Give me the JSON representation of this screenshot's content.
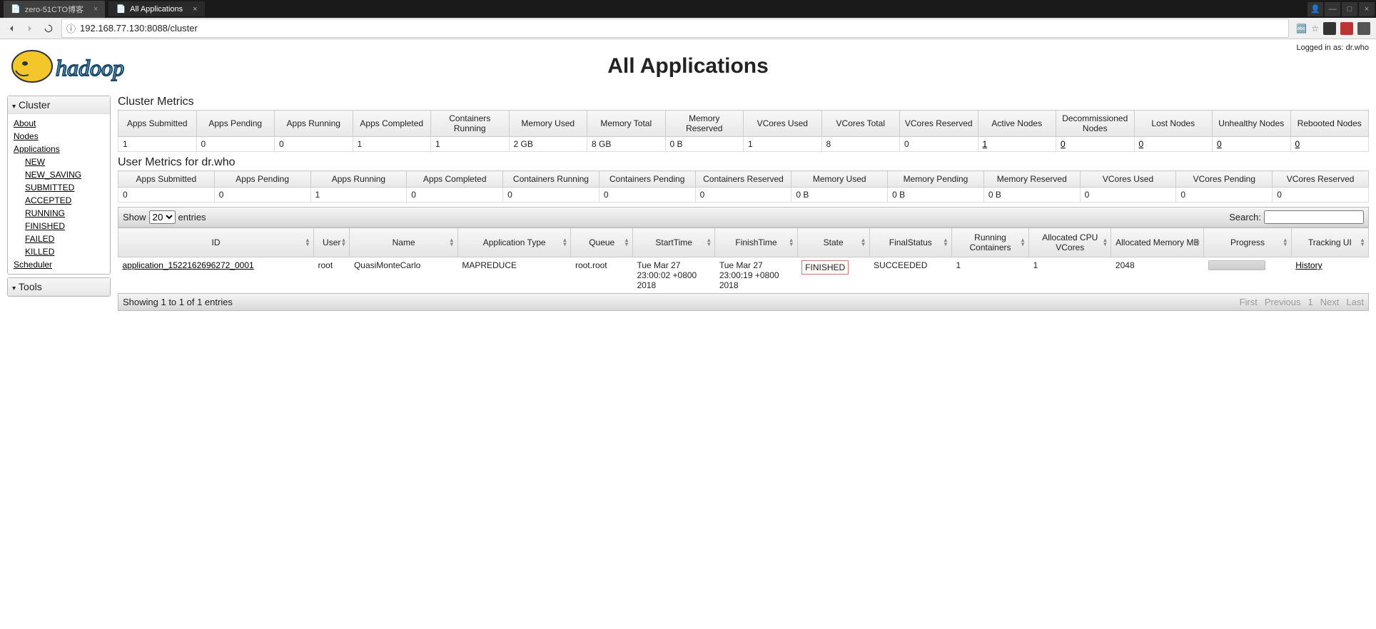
{
  "browser": {
    "tab1": "zero-51CTO博客",
    "tab2": "All Applications",
    "url": "192.168.77.130:8088/cluster"
  },
  "header": {
    "logged_in_prefix": "Logged in as: ",
    "logged_in_user": "dr.who",
    "page_title": "All Applications"
  },
  "sidebar": {
    "cluster_label": "Cluster",
    "about": "About",
    "nodes": "Nodes",
    "applications": "Applications",
    "app_states": [
      "NEW",
      "NEW_SAVING",
      "SUBMITTED",
      "ACCEPTED",
      "RUNNING",
      "FINISHED",
      "FAILED",
      "KILLED"
    ],
    "scheduler": "Scheduler",
    "tools_label": "Tools"
  },
  "cluster_metrics": {
    "title": "Cluster Metrics",
    "headers": [
      "Apps Submitted",
      "Apps Pending",
      "Apps Running",
      "Apps Completed",
      "Containers Running",
      "Memory Used",
      "Memory Total",
      "Memory Reserved",
      "VCores Used",
      "VCores Total",
      "VCores Reserved",
      "Active Nodes",
      "Decommissioned Nodes",
      "Lost Nodes",
      "Unhealthy Nodes",
      "Rebooted Nodes"
    ],
    "values": [
      "1",
      "0",
      "0",
      "1",
      "1",
      "2 GB",
      "8 GB",
      "0 B",
      "1",
      "8",
      "0",
      "1",
      "0",
      "0",
      "0",
      "0"
    ]
  },
  "user_metrics": {
    "title": "User Metrics for dr.who",
    "headers": [
      "Apps Submitted",
      "Apps Pending",
      "Apps Running",
      "Apps Completed",
      "Containers Running",
      "Containers Pending",
      "Containers Reserved",
      "Memory Used",
      "Memory Pending",
      "Memory Reserved",
      "VCores Used",
      "VCores Pending",
      "VCores Reserved"
    ],
    "values": [
      "0",
      "0",
      "1",
      "0",
      "0",
      "0",
      "0",
      "0 B",
      "0 B",
      "0 B",
      "0",
      "0",
      "0"
    ]
  },
  "controls": {
    "show": "Show",
    "entries": "entries",
    "select": "20",
    "search": "Search:"
  },
  "apps_table": {
    "headers": [
      "ID",
      "User",
      "Name",
      "Application Type",
      "Queue",
      "StartTime",
      "FinishTime",
      "State",
      "FinalStatus",
      "Running Containers",
      "Allocated CPU VCores",
      "Allocated Memory MB",
      "Progress",
      "Tracking UI"
    ],
    "row": {
      "id": "application_1522162696272_0001",
      "user": "root",
      "name": "QuasiMonteCarlo",
      "type": "MAPREDUCE",
      "queue": "root.root",
      "start": "Tue Mar 27 23:00:02 +0800 2018",
      "finish": "Tue Mar 27 23:00:19 +0800 2018",
      "state": "FINISHED",
      "final": "SUCCEEDED",
      "running": "1",
      "vcores": "1",
      "mem": "2048",
      "tracking": "History"
    }
  },
  "pager": {
    "info": "Showing 1 to 1 of 1 entries",
    "first": "First",
    "prev": "Previous",
    "page": "1",
    "next": "Next",
    "last": "Last"
  }
}
